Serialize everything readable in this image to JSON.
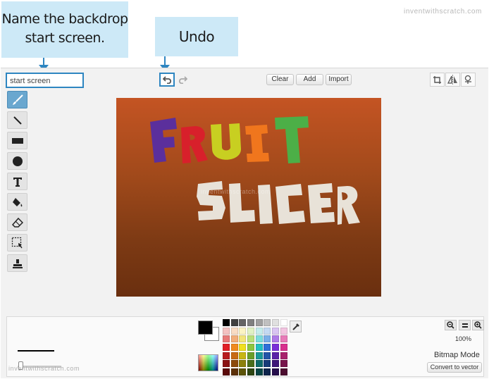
{
  "annotations": {
    "backdrop_callout": "Name the backdrop start screen.",
    "undo_callout": "Undo button"
  },
  "watermark": "inventwithscratch.com",
  "editor": {
    "costume_name_value": "start screen",
    "buttons": {
      "clear": "Clear",
      "add": "Add",
      "import": "Import"
    },
    "top_right_icons": [
      "crop-icon",
      "flip-horizontal-icon",
      "set-center-icon"
    ],
    "tools": [
      "brush-icon",
      "line-icon",
      "rectangle-icon",
      "ellipse-icon",
      "text-icon",
      "fill-icon",
      "eraser-icon",
      "select-icon",
      "stamp-icon"
    ],
    "active_tool": "brush-icon",
    "canvas_art": {
      "line1": "FRUIT",
      "line2": "SLICER",
      "fruit_colors": [
        "#5b2f9c",
        "#d8202b",
        "#c8cf21",
        "#f0761d",
        "#4caf47"
      ],
      "slicer_color": "#e8e2d8",
      "background_top": "#c45423",
      "background_bottom": "#6a2f0f"
    },
    "zoom_level": "100%",
    "mode_label": "Bitmap Mode",
    "convert_button": "Convert to vector",
    "primary_color": "#000000",
    "secondary_color": "#ffffff",
    "palette": [
      "#000000",
      "#404040",
      "#646464",
      "#808080",
      "#a0a0a0",
      "#c0c0c0",
      "#e0e0e0",
      "#ffffff",
      "#f4c2c2",
      "#f9dcc4",
      "#fbf4c4",
      "#e0f2c4",
      "#c4ecec",
      "#c4d9f2",
      "#d9c4f2",
      "#f2c4e0",
      "#e87a7a",
      "#f2ae7a",
      "#f2e47a",
      "#b8e07a",
      "#7adcdc",
      "#7aaee8",
      "#ae7ae8",
      "#e87ab8",
      "#e11f26",
      "#f08a1f",
      "#f0e01f",
      "#8cc63f",
      "#22c0c0",
      "#2f6fd8",
      "#7a2fd8",
      "#d82f8e",
      "#b81b1f",
      "#c86a14",
      "#c8b614",
      "#6a9e2a",
      "#1a9898",
      "#2355a8",
      "#5a22a8",
      "#a8226c",
      "#8a1214",
      "#8c4a0c",
      "#8c800c",
      "#4a6e1c",
      "#0e6a6a",
      "#173a78",
      "#3e1678",
      "#78164c",
      "#5a0a0a",
      "#5c3008",
      "#5c5408",
      "#2e4612",
      "#084444",
      "#0e244c",
      "#260e4c",
      "#4c0e30"
    ]
  }
}
